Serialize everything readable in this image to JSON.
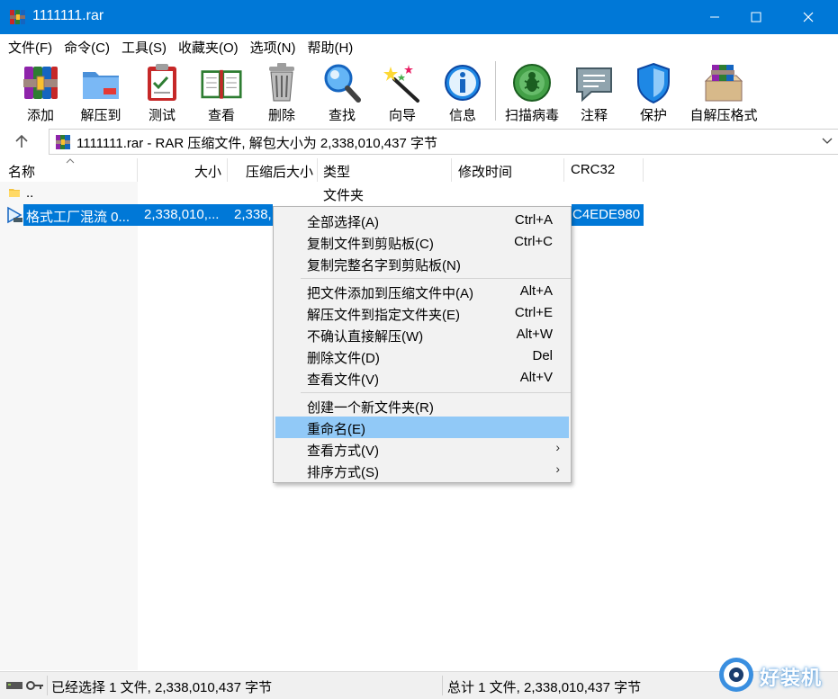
{
  "window": {
    "title": "1111111.rar"
  },
  "menubar": {
    "items": [
      "文件(F)",
      "命令(C)",
      "工具(S)",
      "收藏夹(O)",
      "选项(N)",
      "帮助(H)"
    ]
  },
  "toolbar": {
    "buttons": [
      {
        "label": "添加",
        "icon": "add-archive-icon"
      },
      {
        "label": "解压到",
        "icon": "extract-to-folder-icon"
      },
      {
        "label": "测试",
        "icon": "test-clipboard-icon"
      },
      {
        "label": "查看",
        "icon": "view-book-icon"
      },
      {
        "label": "删除",
        "icon": "trash-can-icon"
      },
      {
        "label": "查找",
        "icon": "magnifier-icon"
      },
      {
        "label": "向导",
        "icon": "magic-wand-icon"
      },
      {
        "label": "信息",
        "icon": "info-icon"
      },
      {
        "label": "扫描病毒",
        "icon": "virus-scan-icon"
      },
      {
        "label": "注释",
        "icon": "comment-icon"
      },
      {
        "label": "保护",
        "icon": "shield-icon"
      },
      {
        "label": "自解压格式",
        "icon": "sfx-archive-icon"
      }
    ]
  },
  "addressbar": {
    "path_text": "1111111.rar - RAR 压缩文件, 解包大小为 2,338,010,437 字节"
  },
  "columns": {
    "name": "名称",
    "size": "大小",
    "packed": "压缩后大小",
    "type": "类型",
    "modified": "修改时间",
    "crc": "CRC32"
  },
  "rows": [
    {
      "name": "..",
      "size": "",
      "packed": "",
      "type": "文件夹",
      "modified": "",
      "crc": ""
    },
    {
      "name": "格式工厂混流 0...",
      "size": "2,338,010,...",
      "packed": "2,338,",
      "type": "",
      "modified": "",
      "crc": "C4EDE980"
    }
  ],
  "context_menu": {
    "items": [
      {
        "label": "全部选择(A)",
        "shortcut": "Ctrl+A"
      },
      {
        "label": "复制文件到剪贴板(C)",
        "shortcut": "Ctrl+C"
      },
      {
        "label": "复制完整名字到剪贴板(N)",
        "shortcut": ""
      },
      {
        "label": "把文件添加到压缩文件中(A)",
        "shortcut": "Alt+A"
      },
      {
        "label": "解压文件到指定文件夹(E)",
        "shortcut": "Ctrl+E"
      },
      {
        "label": "不确认直接解压(W)",
        "shortcut": "Alt+W"
      },
      {
        "label": "删除文件(D)",
        "shortcut": "Del"
      },
      {
        "label": "查看文件(V)",
        "shortcut": "Alt+V"
      },
      {
        "label": "创建一个新文件夹(R)",
        "shortcut": ""
      },
      {
        "label": "重命名(E)",
        "shortcut": ""
      },
      {
        "label": "查看方式(V)",
        "shortcut": ""
      },
      {
        "label": "排序方式(S)",
        "shortcut": ""
      }
    ],
    "highlighted_item": "重命名(E)"
  },
  "statusbar": {
    "left": "已经选择 1 文件, 2,338,010,437 字节",
    "right": "总计 1 文件, 2,338,010,437 字节"
  },
  "watermark": {
    "text": "好装机"
  },
  "colors": {
    "titlebar": "#0078d7",
    "selection": "#0078d7",
    "menu_hover": "#91c9f7"
  }
}
